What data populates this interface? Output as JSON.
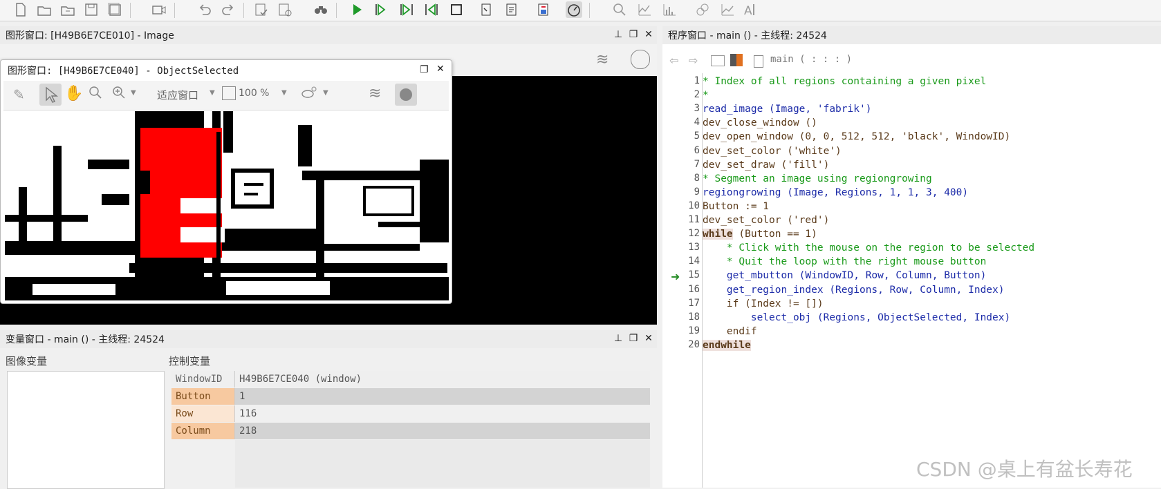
{
  "toolbar": {
    "icons": [
      "new-file-icon",
      "open-folder-icon",
      "open-example-icon",
      "save-icon",
      "save-all-icon",
      "camera-icon",
      "undo-icon",
      "redo-icon",
      "check-program-icon",
      "clear-program-icon",
      "binoculars-icon",
      "run-icon",
      "step-over-icon",
      "step-into-icon",
      "step-out-icon",
      "stop-icon",
      "reset-program-icon",
      "read-program-icon",
      "insert-code-icon",
      "profiler-icon",
      "zoom-icon",
      "histogram-icon",
      "line-profile-icon",
      "gray-histogram-icon",
      "feature-histogram-icon",
      "ocr-icon"
    ]
  },
  "image_window": {
    "title": "图形窗口: [H49B6E7CE010] - Image",
    "sub_window": {
      "title": "图形窗口: [H49B6E7CE040] - ObjectSelected",
      "fit_label": "适应窗口",
      "zoom_label": "100 %"
    }
  },
  "variable_window": {
    "title": "变量窗口 - main () - 主线程: 24524",
    "image_vars_label": "图像变量",
    "control_vars_label": "控制变量",
    "control_vars": [
      {
        "name": "WindowID",
        "value": "H49B6E7CE040 (window)"
      },
      {
        "name": "Button",
        "value": "1"
      },
      {
        "name": "Row",
        "value": "116"
      },
      {
        "name": "Column",
        "value": "218"
      }
    ]
  },
  "program_window": {
    "title": "程序窗口 - main () - 主线程: 24524",
    "procedure_label": "main ( : : : )",
    "current_line": "15",
    "lines": [
      {
        "n": "1",
        "text": "* Index of all regions containing a given pixel",
        "kind": "com"
      },
      {
        "n": "2",
        "text": "*",
        "kind": "com"
      },
      {
        "n": "3",
        "text": "read_image (Image, 'fabrik')",
        "kind": "op"
      },
      {
        "n": "4",
        "text": "dev_close_window ()",
        "kind": "txt"
      },
      {
        "n": "5",
        "text": "dev_open_window (0, 0, 512, 512, 'black', WindowID)",
        "kind": "txt"
      },
      {
        "n": "6",
        "text": "dev_set_color ('white')",
        "kind": "txt"
      },
      {
        "n": "7",
        "text": "dev_set_draw ('fill')",
        "kind": "txt"
      },
      {
        "n": "8",
        "text": "* Segment an image using regiongrowing",
        "kind": "com"
      },
      {
        "n": "9",
        "text": "regiongrowing (Image, Regions, 1, 1, 3, 400)",
        "kind": "op"
      },
      {
        "n": "10",
        "text": "Button := 1",
        "kind": "txt"
      },
      {
        "n": "11",
        "text": "dev_set_color ('red')",
        "kind": "txt"
      },
      {
        "n": "12",
        "kw": "while",
        "text": " (Button == 1)",
        "kind": "kwline"
      },
      {
        "n": "13",
        "text": "    * Click with the mouse on the region to be selected",
        "kind": "com"
      },
      {
        "n": "14",
        "text": "    * Quit the loop with the right mouse button",
        "kind": "com"
      },
      {
        "n": "15",
        "text": "    get_mbutton (WindowID, Row, Column, Button)",
        "kind": "op"
      },
      {
        "n": "16",
        "text": "    get_region_index (Regions, Row, Column, Index)",
        "kind": "op"
      },
      {
        "n": "17",
        "text": "    if (Index != [])",
        "kind": "txt"
      },
      {
        "n": "18",
        "text": "        select_obj (Regions, ObjectSelected, Index)",
        "kind": "op"
      },
      {
        "n": "19",
        "text": "    endif",
        "kind": "txt"
      },
      {
        "n": "20",
        "kw": "endwhile",
        "text": "",
        "kind": "kwline"
      }
    ]
  },
  "watermark": "CSDN @桌上有盆长寿花",
  "colors": {
    "selected_region": "#ff0000",
    "comment": "#1a9a1a",
    "operator": "#1c2ba8"
  }
}
